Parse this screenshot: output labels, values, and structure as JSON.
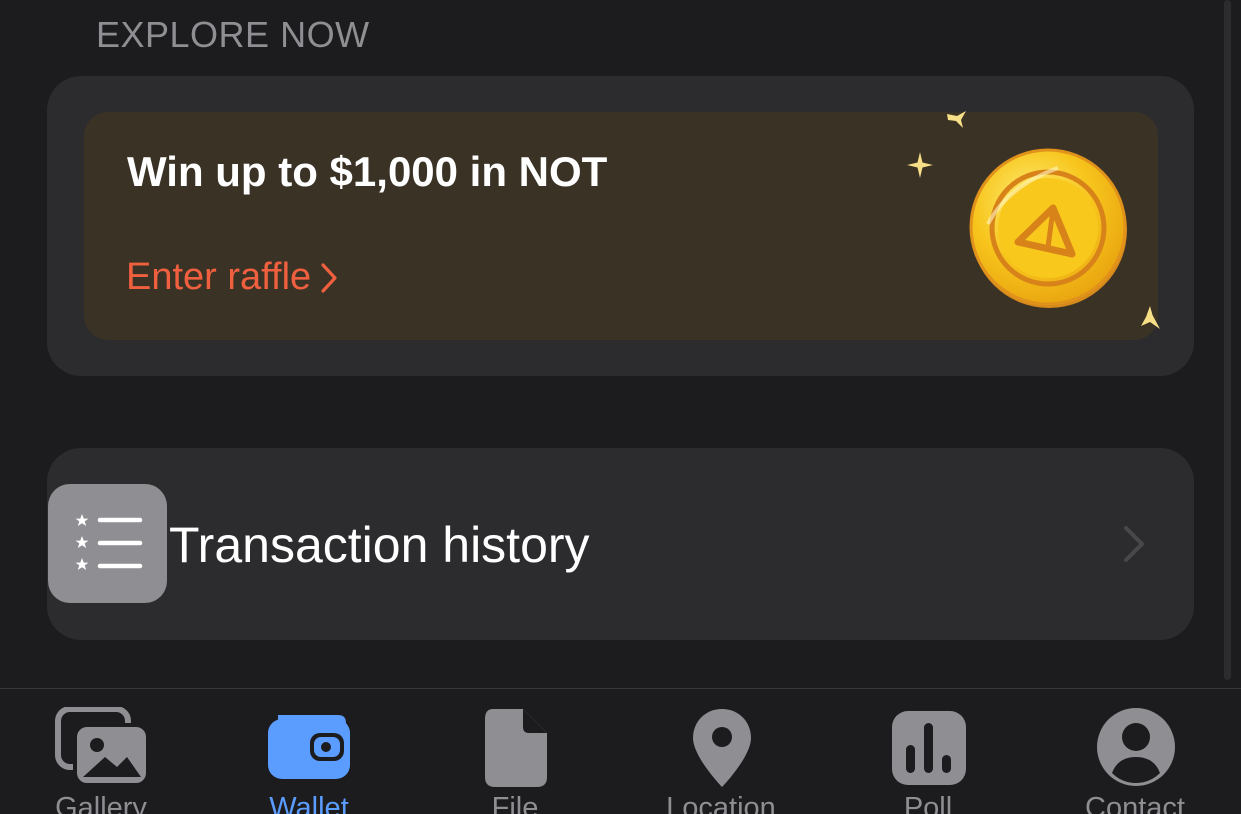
{
  "section_header": "EXPLORE NOW",
  "promo": {
    "title": "Win up to $1,000 in NOT",
    "action_label": "Enter raffle",
    "icon": "not-coin-icon",
    "accent_color": "#f0603f",
    "card_color": "#3a3225"
  },
  "transaction_history": {
    "label": "Transaction history",
    "icon": "starred-list-icon",
    "chevron_icon": "chevron-right-icon"
  },
  "tabbar": {
    "active_tab": "Wallet",
    "active_color": "#5b9cff",
    "inactive_color": "#8e8e93",
    "tabs": [
      {
        "label": "Gallery",
        "icon": "gallery-icon"
      },
      {
        "label": "Wallet",
        "icon": "wallet-icon"
      },
      {
        "label": "File",
        "icon": "file-icon"
      },
      {
        "label": "Location",
        "icon": "location-pin-icon"
      },
      {
        "label": "Poll",
        "icon": "poll-icon"
      },
      {
        "label": "Contact",
        "icon": "contact-icon"
      }
    ]
  }
}
